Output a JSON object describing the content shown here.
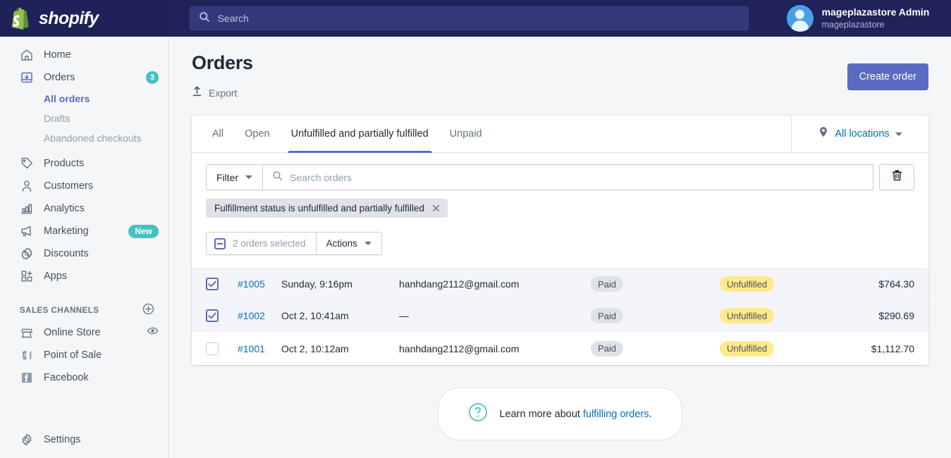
{
  "topbar": {
    "logo_word": "shopify",
    "logo_icon": "shopify-bag-icon",
    "search_placeholder": "Search",
    "search_icon": "search-icon",
    "user_name": "mageplazastore Admin",
    "user_store": "mageplazastore",
    "avatar_icon": "user-avatar-icon"
  },
  "sidebar": {
    "items": [
      {
        "label": "Home",
        "icon": "home-icon",
        "badge": ""
      },
      {
        "label": "Orders",
        "icon": "orders-inbox-icon",
        "badge": "3"
      },
      {
        "label": "Products",
        "icon": "products-tag-icon",
        "badge": ""
      },
      {
        "label": "Customers",
        "icon": "customers-person-icon",
        "badge": ""
      },
      {
        "label": "Analytics",
        "icon": "analytics-bars-icon",
        "badge": ""
      },
      {
        "label": "Marketing",
        "icon": "marketing-megaphone-icon",
        "badge": "New"
      },
      {
        "label": "Discounts",
        "icon": "discounts-percent-icon",
        "badge": ""
      },
      {
        "label": "Apps",
        "icon": "apps-grid-plus-icon",
        "badge": ""
      }
    ],
    "suborders": [
      {
        "label": "All orders",
        "active": true
      },
      {
        "label": "Drafts",
        "active": false
      },
      {
        "label": "Abandoned checkouts",
        "active": false
      }
    ],
    "sales_channels_title": "SALES CHANNELS",
    "sales_channels_add_icon": "plus-circle-icon",
    "channels": [
      {
        "label": "Online Store",
        "icon": "online-store-icon",
        "trailing_icon": "eye-icon"
      },
      {
        "label": "Point of Sale",
        "icon": "point-of-sale-icon",
        "trailing_icon": ""
      },
      {
        "label": "Facebook",
        "icon": "facebook-icon",
        "trailing_icon": ""
      }
    ],
    "settings": {
      "label": "Settings",
      "icon": "gear-icon"
    }
  },
  "page": {
    "title": "Orders",
    "export_label": "Export",
    "export_icon": "upload-icon",
    "create_order_label": "Create order"
  },
  "tabs": [
    {
      "label": "All",
      "active": false
    },
    {
      "label": "Open",
      "active": false
    },
    {
      "label": "Unfulfilled and partially fulfilled",
      "active": true
    },
    {
      "label": "Unpaid",
      "active": false
    }
  ],
  "locations": {
    "label": "All locations",
    "icon": "location-pin-icon",
    "caret_icon": "chevron-down-icon"
  },
  "filters": {
    "filter_label": "Filter",
    "filter_caret_icon": "chevron-down-icon",
    "search_placeholder": "Search orders",
    "search_icon": "search-icon",
    "trash_icon": "trash-icon",
    "chips": [
      {
        "label": "Fulfillment status is unfulfilled and partially fulfilled",
        "remove_icon": "close-icon"
      }
    ]
  },
  "bulk": {
    "selected_label": "2 orders selected",
    "indeterminate_icon": "indeterminate-checkbox-icon",
    "actions_label": "Actions",
    "actions_caret_icon": "chevron-down-icon"
  },
  "table": {
    "rows": [
      {
        "checked": true,
        "order": "#1005",
        "date": "Sunday, 9:16pm",
        "email": "hanhdang2112@gmail.com",
        "payment": "Paid",
        "fulfillment": "Unfulfilled",
        "total": "$764.30"
      },
      {
        "checked": true,
        "order": "#1002",
        "date": "Oct 2, 10:41am",
        "email": "—",
        "payment": "Paid",
        "fulfillment": "Unfulfilled",
        "total": "$290.69"
      },
      {
        "checked": false,
        "order": "#1001",
        "date": "Oct 2, 10:12am",
        "email": "hanhdang2112@gmail.com",
        "payment": "Paid",
        "fulfillment": "Unfulfilled",
        "total": "$1,112.70"
      }
    ]
  },
  "footer": {
    "help_icon": "question-circle-icon",
    "help_text": "Learn more about ",
    "help_link": "fulfilling orders",
    "help_suffix": "."
  },
  "colors": {
    "brand_navy": "#1f2359",
    "accent_indigo": "#5c6ac4",
    "teal_badge": "#47c1bf",
    "link_blue": "#006fbb",
    "pill_yellow": "#ffea8a",
    "pill_grey": "#dfe3e8",
    "page_bg": "#f4f6f8"
  }
}
